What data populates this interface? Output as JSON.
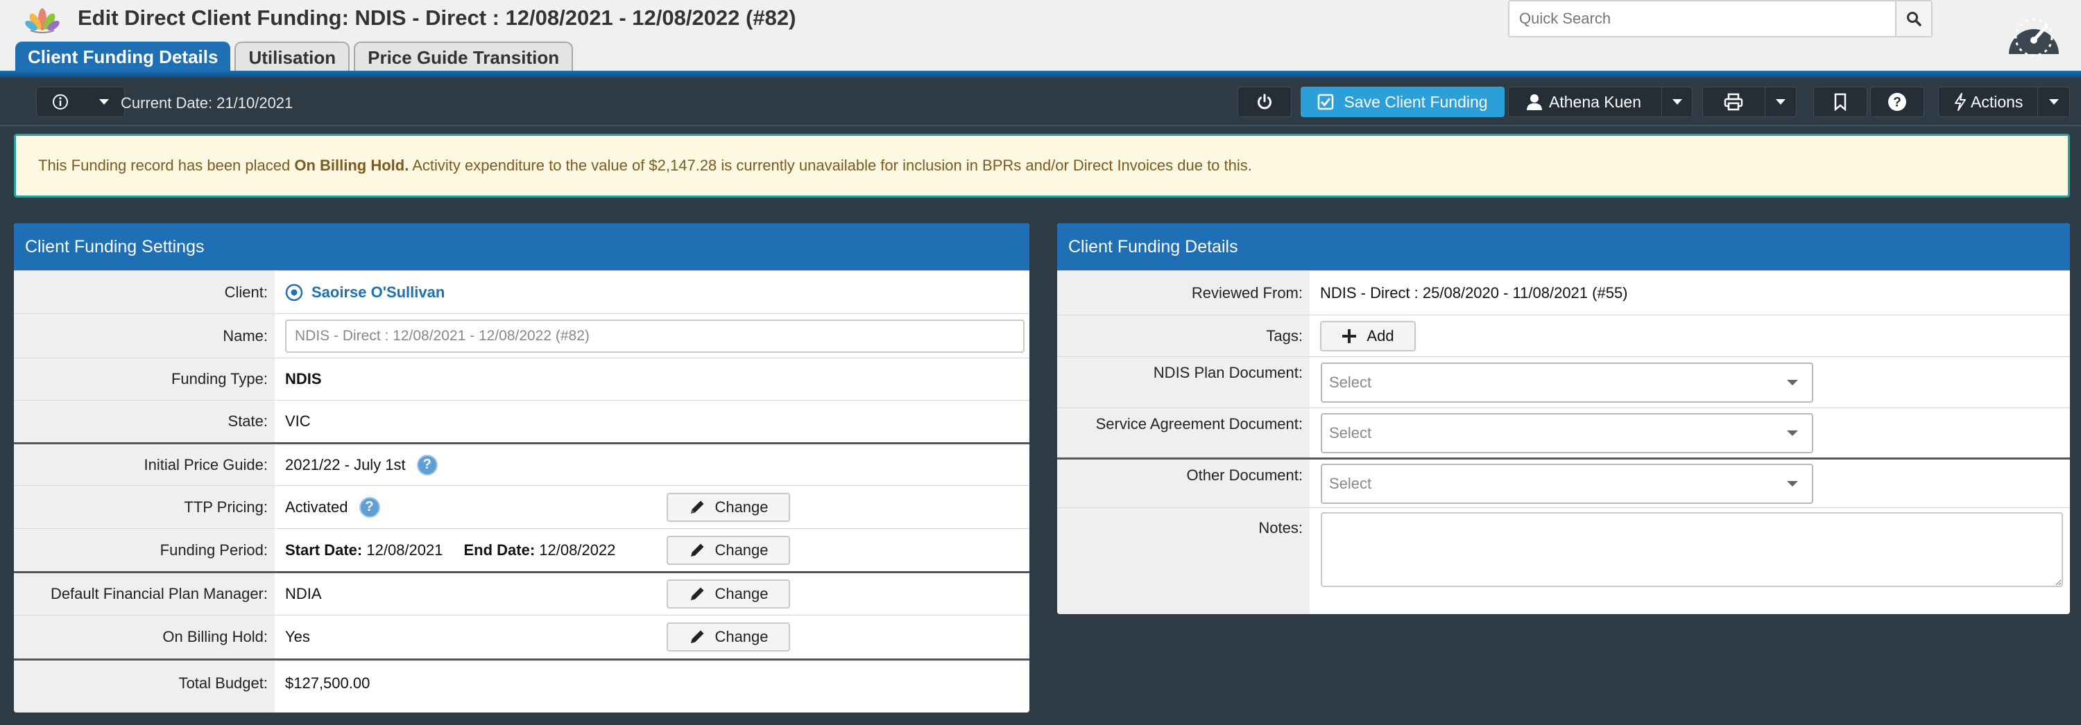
{
  "header": {
    "title": "Edit Direct Client Funding:  NDIS - Direct : 12/08/2021 - 12/08/2022 (#82)",
    "search_placeholder": "Quick Search"
  },
  "tabs": [
    {
      "label": "Client Funding Details",
      "active": true
    },
    {
      "label": "Utilisation",
      "active": false
    },
    {
      "label": "Price Guide Transition",
      "active": false
    }
  ],
  "toolbar": {
    "current_date": "Current Date: 21/10/2021",
    "save_label": "Save Client Funding",
    "user_label": "Athena Kuen",
    "actions_label": "Actions"
  },
  "alert": {
    "text_before": "This Funding record has been placed ",
    "bold": "On Billing Hold.",
    "text_after": " Activity expenditure to the value of $2,147.28 is currently unavailable for inclusion in BPRs and/or Direct Invoices due to this."
  },
  "settings_panel": {
    "title": "Client Funding Settings",
    "client_label": "Client:",
    "client_value": "Saoirse O'Sullivan",
    "name_label": "Name:",
    "name_value": "NDIS - Direct : 12/08/2021 - 12/08/2022 (#82)",
    "funding_type_label": "Funding Type:",
    "funding_type_value": "NDIS",
    "state_label": "State:",
    "state_value": "VIC",
    "price_guide_label": "Initial Price Guide:",
    "price_guide_value": "2021/22 - July 1st",
    "ttp_label": "TTP Pricing:",
    "ttp_value": "Activated",
    "period_label": "Funding Period:",
    "start_label": "Start Date:",
    "start_value": "12/08/2021",
    "end_label": "End Date:",
    "end_value": "12/08/2022",
    "plan_manager_label": "Default Financial Plan Manager:",
    "plan_manager_value": "NDIA",
    "billing_hold_label": "On Billing Hold:",
    "billing_hold_value": "Yes",
    "total_budget_label": "Total Budget:",
    "total_budget_value": "$127,500.00",
    "change_label": "Change"
  },
  "details_panel": {
    "title": "Client Funding Details",
    "reviewed_from_label": "Reviewed From:",
    "reviewed_from_value": "NDIS - Direct : 25/08/2020 - 11/08/2021 (#55)",
    "tags_label": "Tags:",
    "add_label": "Add",
    "ndis_plan_label": "NDIS Plan Document:",
    "service_agreement_label": "Service Agreement Document:",
    "other_doc_label": "Other Document:",
    "select_placeholder": "Select",
    "notes_label": "Notes:"
  },
  "colors": {
    "brand_blue": "#1e6fb3",
    "save_blue": "#2b9fd8",
    "alert_bg": "#fcf8e1",
    "alert_border": "#2aa39a",
    "toolbar_bg": "#2e3a44"
  }
}
